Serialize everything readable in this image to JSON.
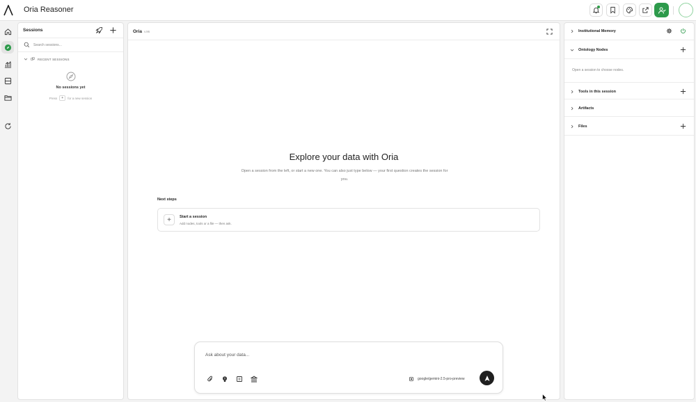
{
  "app": {
    "title": "Oria Reasoner"
  },
  "topbar": {
    "icons": [
      "bell-icon",
      "bookmark-icon",
      "palette-icon",
      "share-icon",
      "user-check-icon"
    ],
    "accent_color": "#2d9a4b"
  },
  "rail": {
    "items": [
      "home-icon",
      "compass-icon",
      "chart-icon",
      "layers-icon",
      "folder-icon",
      "refresh-icon"
    ]
  },
  "sessions": {
    "title": "Sessions",
    "search_placeholder": "Search sessions...",
    "recent_label": "RECENT SESSIONS",
    "empty_title": "No sessions yet",
    "hint_press": "Press",
    "hint_key": "+",
    "hint_rest": "for a new session"
  },
  "main": {
    "title": "Oria",
    "version": "v.96",
    "hero_title": "Explore your data with Oria",
    "hero_subtitle": "Open a session from the left, or start a new one. You can also just type below — your first question creates the session for you.",
    "next_steps_label": "Next steps",
    "next_card": {
      "title": "Start a session",
      "description": "Add nodes, tools or a file — then ask."
    },
    "composer": {
      "placeholder": "Ask about your data...",
      "model": "google/gemini-2.5-pro-preview"
    }
  },
  "right": {
    "institutional_memory": "Institutional Memory",
    "ontology_nodes": "Ontology Nodes",
    "ontology_note": "Open a session to choose nodes.",
    "tools": "Tools in this session",
    "artifacts": "Artifacts",
    "files": "Files"
  }
}
